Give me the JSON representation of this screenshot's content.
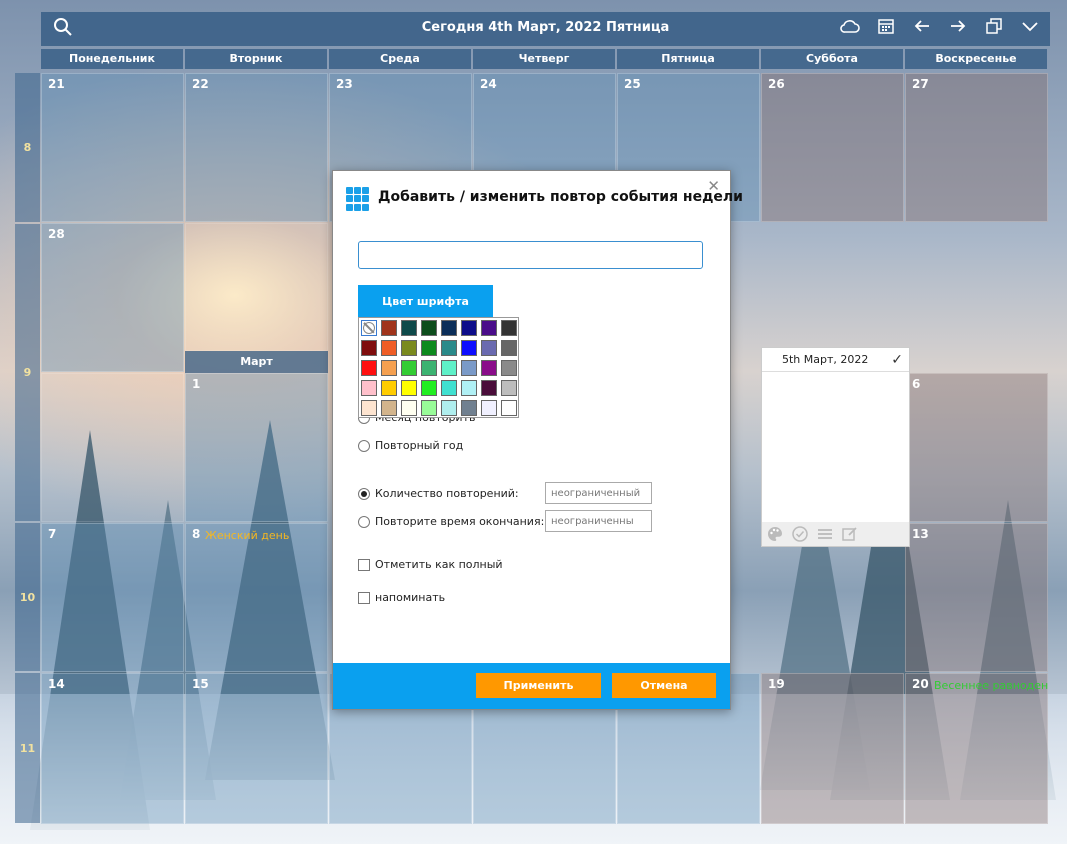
{
  "header": {
    "title": "Сегодня 4th Март, 2022 Пятница",
    "icons": [
      "search-icon",
      "cloud-icon",
      "calendar-icon",
      "arrow-left-icon",
      "arrow-right-icon",
      "copy-icon",
      "chevron-down-icon"
    ]
  },
  "weekdays": [
    "Понедельник",
    "Вторник",
    "Среда",
    "Четверг",
    "Пятница",
    "Суббота",
    "Воскресенье"
  ],
  "week_numbers": [
    "8",
    "9",
    "10",
    "11"
  ],
  "month_label": "Март",
  "days": {
    "r1": [
      "21",
      "22",
      "23",
      "24",
      "25",
      "26",
      "27"
    ],
    "r2_first": "28",
    "r3_first": "1",
    "r3_last": "6",
    "r4": {
      "mon": "7",
      "tue": "8",
      "sun": "13"
    },
    "r5": {
      "mon": "14",
      "tue": "15",
      "sat": "19",
      "sun": "20"
    }
  },
  "events": {
    "womens_day": "Женский день",
    "spring_equinox": "Весеннее равноден"
  },
  "popup": {
    "date": "5th Март, 2022"
  },
  "dialog": {
    "title": "Добавить / изменить повтор события недели",
    "input_value": "",
    "font_color_button": "Цвет шрифта",
    "palette_colors": [
      "none",
      "#a0341b",
      "#0e4a4a",
      "#0d4d1c",
      "#0b2e59",
      "#0d0d8a",
      "#4a0d8a",
      "#333333",
      "#7f0d0d",
      "#ef5d26",
      "#7a8a1e",
      "#0d8a1e",
      "#2a8a8a",
      "#0d0dff",
      "#6a6ab0",
      "#666666",
      "#ff1010",
      "#f5a050",
      "#33cc33",
      "#3cb371",
      "#5ef0c8",
      "#7a9ac8",
      "#8a0d8a",
      "#8a8a8a",
      "#ffc0cb",
      "#ffcc00",
      "#ffff00",
      "#22ee22",
      "#40e0d0",
      "#b0f0f5",
      "#4a0d3a",
      "#bdbdbd",
      "#fde4d0",
      "#d2b48c",
      "#fffff0",
      "#98fb98",
      "#afeeee",
      "#708090",
      "#f0f0ff",
      "#ffffff"
    ],
    "partial_hidden_label": "е",
    "month_repeat": "Месяц повторить",
    "year_repeat": "Повторный год",
    "repeat_count_label": "Количество повторений:",
    "repeat_count_value": "неограниченный",
    "end_time_label": "Повторите время окончания:",
    "end_time_value": "неограниченны",
    "mark_complete": "Отметить как полный",
    "remind": "напоминать",
    "apply": "Применить",
    "cancel": "Отмена"
  }
}
